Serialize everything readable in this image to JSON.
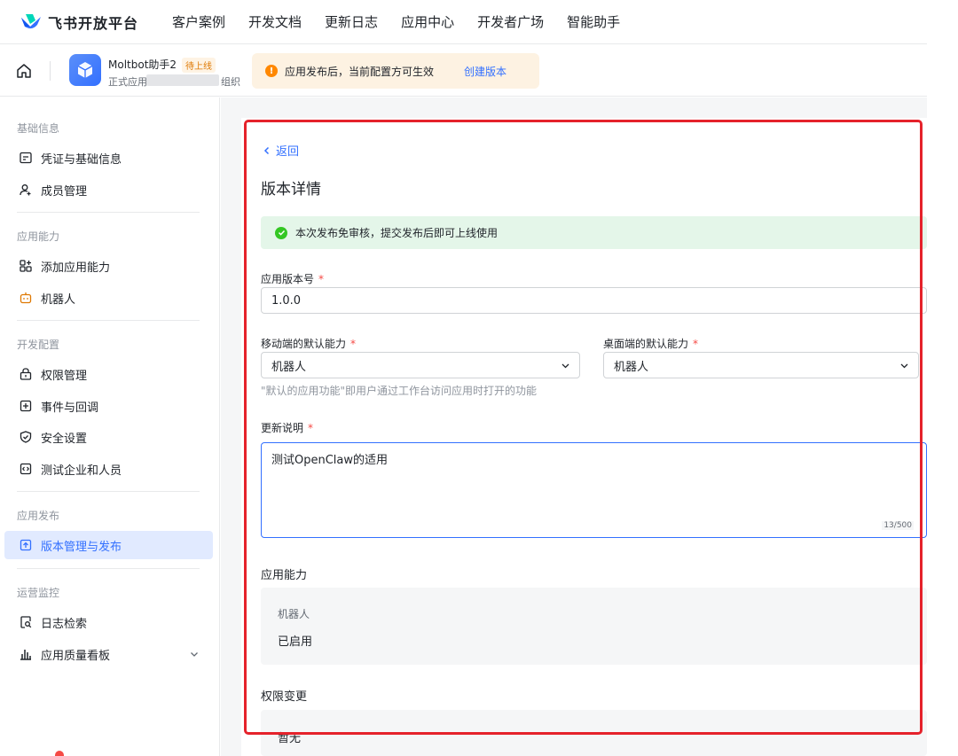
{
  "brand": {
    "name": "飞书开放平台",
    "icon": "feishu-logo-icon"
  },
  "nav": [
    "客户案例",
    "开发文档",
    "更新日志",
    "应用中心",
    "开发者广场",
    "智能助手"
  ],
  "app": {
    "name": "Moltbot助手2",
    "badge": "待上线",
    "subtitle_prefix": "正式应用",
    "subtitle_suffix": "组织"
  },
  "notice": {
    "text": "应用发布后，当前配置方可生效",
    "link": "创建版本"
  },
  "sidebar": {
    "sections": [
      "基础信息",
      "应用能力",
      "开发配置",
      "应用发布",
      "运营监控"
    ],
    "items": [
      {
        "label": "凭证与基础信息",
        "icon": "credential-icon"
      },
      {
        "label": "成员管理",
        "icon": "member-add-icon"
      },
      {
        "label": "添加应用能力",
        "icon": "app-grid-add-icon"
      },
      {
        "label": "机器人",
        "icon": "robot-icon"
      },
      {
        "label": "权限管理",
        "icon": "lock-icon"
      },
      {
        "label": "事件与回调",
        "icon": "event-callback-icon"
      },
      {
        "label": "安全设置",
        "icon": "shield-check-icon"
      },
      {
        "label": "测试企业和人员",
        "icon": "code-test-icon"
      },
      {
        "label": "版本管理与发布",
        "icon": "upload-version-icon",
        "active": true
      },
      {
        "label": "日志检索",
        "icon": "log-search-icon"
      },
      {
        "label": "应用质量看板",
        "icon": "bar-chart-icon"
      }
    ]
  },
  "main": {
    "back": "返回",
    "title": "版本详情",
    "alert": "本次发布免审核，提交发布后即可上线使用",
    "version_label": "应用版本号",
    "version_value": "1.0.0",
    "mobile_label": "移动端的默认能力",
    "mobile_value": "机器人",
    "desktop_label": "桌面端的默认能力",
    "desktop_value": "机器人",
    "hint": "\"默认的应用功能\"即用户通过工作台访问应用时打开的功能",
    "notes_label": "更新说明",
    "notes_value": "测试OpenClaw的适用",
    "notes_counter": "13/500",
    "capability_title": "应用能力",
    "capability_name": "机器人",
    "capability_status": "已启用",
    "permission_title": "权限变更",
    "permission_value": "暂无",
    "required_mark": "*"
  },
  "colors": {
    "accent": "#3370ff",
    "highlight_border": "#e5222b",
    "success_bg": "#e4f6e9",
    "notice_bg": "#fdf2e2"
  }
}
